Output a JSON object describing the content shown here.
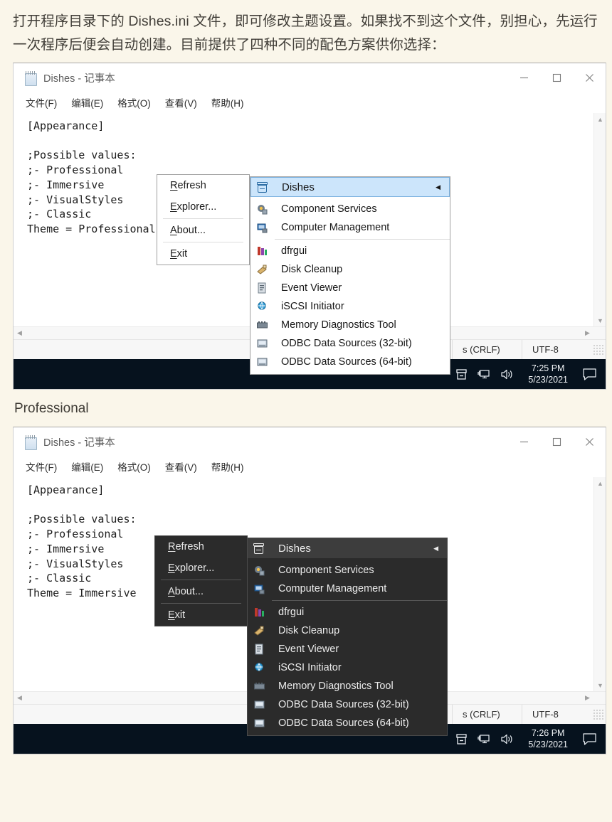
{
  "intro": {
    "paragraph": "打开程序目录下的 Dishes.ini 文件，即可修改主题设置。如果找不到这个文件，别担心，先运行一次程序后便会自动创建。目前提供了四种不同的配色方案供你选择："
  },
  "caption": {
    "professional": "Professional"
  },
  "window": {
    "title": "Dishes - 记事本",
    "icon": "notepad-icon",
    "controls": {
      "minimize": "minimize-button",
      "maximize": "maximize-button",
      "close": "close-button"
    },
    "menubar": [
      "文件(F)",
      "编辑(E)",
      "格式(O)",
      "查看(V)",
      "帮助(H)"
    ],
    "statusbar": {
      "line_ending": "s (CRLF)",
      "encoding": "UTF-8"
    }
  },
  "editor": {
    "professional_text": "[Appearance]\n\n;Possible values:\n;- Professional\n;- Immersive\n;- VisualStyles\n;- Classic\nTheme = Professional",
    "immersive_text": "[Appearance]\n\n;Possible values:\n;- Professional\n;- Immersive\n;- VisualStyles\n;- Classic\nTheme = Immersive"
  },
  "context_menu": {
    "items": [
      {
        "label": "Refresh",
        "accel": "R"
      },
      {
        "label": "Explorer...",
        "accel": "E"
      },
      {
        "label": "About...",
        "accel": "A"
      },
      {
        "label": "Exit",
        "accel": "E"
      }
    ]
  },
  "submenu": {
    "header": {
      "label": "Dishes",
      "icon": "dishes-icon",
      "arrow": "◀"
    },
    "items": [
      {
        "label": "Component Services",
        "icon": "component-services-icon"
      },
      {
        "label": "Computer Management",
        "icon": "computer-management-icon"
      },
      {
        "label": "dfrgui",
        "icon": "defrag-icon"
      },
      {
        "label": "Disk Cleanup",
        "icon": "disk-cleanup-icon"
      },
      {
        "label": "Event Viewer",
        "icon": "event-viewer-icon"
      },
      {
        "label": "iSCSI Initiator",
        "icon": "iscsi-icon"
      },
      {
        "label": "Memory Diagnostics Tool",
        "icon": "memory-diagnostics-icon"
      },
      {
        "label": "ODBC Data Sources (32-bit)",
        "icon": "odbc-32-icon"
      },
      {
        "label": "ODBC Data Sources (64-bit)",
        "icon": "odbc-64-icon"
      }
    ]
  },
  "taskbar_1": {
    "time": "7:25 PM",
    "date": "5/23/2021",
    "tray_icons": [
      "dishes-tray-icon",
      "network-icon",
      "volume-icon"
    ],
    "action_center": "action-center-icon"
  },
  "taskbar_2": {
    "time": "7:26 PM",
    "date": "5/23/2021",
    "tray_icons": [
      "dishes-tray-icon",
      "network-icon",
      "volume-icon"
    ],
    "action_center": "action-center-icon"
  },
  "colors": {
    "page_bg": "#faf6ea",
    "taskbar_bg": "#06121e",
    "menu_light_bg": "#ffffff",
    "menu_dark_bg": "#2b2b2b",
    "highlight_blue": "#cce5fb",
    "highlight_dark": "#3d3d3d"
  }
}
